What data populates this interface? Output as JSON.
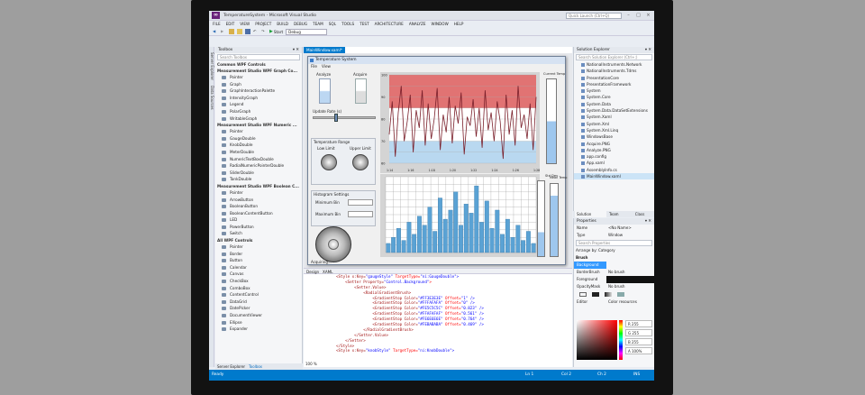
{
  "window": {
    "title": "TemperatureSystem - Microsoft Visual Studio",
    "quick_launch": "Quick Launch (Ctrl+Q)"
  },
  "menu": [
    "FILE",
    "EDIT",
    "VIEW",
    "PROJECT",
    "BUILD",
    "DEBUG",
    "TEAM",
    "SQL",
    "TOOLS",
    "TEST",
    "ARCHITECTURE",
    "ANALYZE",
    "WINDOW",
    "HELP"
  ],
  "toolbar": {
    "start_label": "Start",
    "config": "Debug"
  },
  "left_tabs": [
    "Server Explorer",
    "Data Sources"
  ],
  "toolbox": {
    "title": "Toolbox",
    "search": "Search Toolbox",
    "groups": [
      {
        "name": "Common WPF Controls",
        "items": []
      },
      {
        "name": "Measurement Studio WPF Graph Co...",
        "items": [
          "Pointer",
          "Graph",
          "GraphInteractionPalette",
          "IntensityGraph",
          "Legend",
          "PolarGraph",
          "WritableGraph"
        ]
      },
      {
        "name": "Measurement Studio WPF Numeric ...",
        "items": [
          "Pointer",
          "GaugeDouble",
          "KnobDouble",
          "MeterDouble",
          "NumericTextBoxDouble",
          "RadialNumericPointerDouble",
          "SliderDouble",
          "TankDouble"
        ]
      },
      {
        "name": "Measurement Studio WPF Boolean C...",
        "items": [
          "Pointer",
          "ArrowButton",
          "BooleanButton",
          "BooleanContentButton",
          "LED",
          "PowerButton",
          "Switch"
        ]
      },
      {
        "name": "All WPF Controls",
        "items": [
          "Pointer",
          "Border",
          "Button",
          "Calendar",
          "Canvas",
          "CheckBox",
          "ComboBox",
          "ContentControl",
          "DataGrid",
          "DatePicker",
          "DocumentViewer",
          "Ellipse",
          "Expander"
        ]
      }
    ],
    "bottom_tabs": [
      "Server Explorer",
      "Toolbox"
    ]
  },
  "editor": {
    "tab": "MainWindow.xaml*",
    "zoom": "100 %",
    "split_labels": [
      "Design",
      "XAML"
    ],
    "code": [
      [
        "<Style x:Key=",
        "\"gaugeStyle\"",
        " TargetType=",
        "\"ni:GaugeDouble\">"
      ],
      [
        "    <Setter Property=",
        "\"Control.Background\"",
        ">",
        ""
      ],
      [
        "        <Setter.Value>",
        "",
        "",
        ""
      ],
      [
        "            <RadialGradientBrush>",
        "",
        "",
        ""
      ],
      [
        "                <GradientStop Color=",
        "\"#FF3E3E3E\"",
        " Offset=",
        "\"1\" />"
      ],
      [
        "                <GradientStop Color=",
        "\"#FFFAFAFA\"",
        " Offset=",
        "\"0\" />"
      ],
      [
        "                <GradientStop Color=",
        "\"#FE5C5C5C\"",
        " Offset=",
        "\"0.823\" />"
      ],
      [
        "                <GradientStop Color=",
        "\"#FFAFAFAF\"",
        " Offset=",
        "\"0.561\" />"
      ],
      [
        "                <GradientStop Color=",
        "\"#FE6E6E6E\"",
        " Offset=",
        "\"0.764\" />"
      ],
      [
        "                <GradientStop Color=",
        "\"#FEBABABA\"",
        " Offset=",
        "\"0.469\" />"
      ],
      [
        "            </RadialGradientBrush>",
        "",
        "",
        ""
      ],
      [
        "        </Setter.Value>",
        "",
        "",
        ""
      ],
      [
        "    </Setter>",
        "",
        "",
        ""
      ],
      [
        "</Style>",
        "",
        "",
        ""
      ],
      [
        "<Style x:Key=",
        "\"knobStyle\"",
        " TargetType=",
        "\"ni:KnobDouble\">"
      ]
    ]
  },
  "app_window": {
    "title": "Temperature System",
    "menu": [
      "File",
      "View"
    ],
    "analyze_label": "Analyze",
    "acquire_label": "Acquire",
    "update_rate_label": "Update Rate (s)",
    "temp_range_label": "Temperature Range",
    "low_limit_label": "Low Limit",
    "upper_limit_label": "Upper Limit",
    "histogram_label": "Histogram Settings",
    "min_bin_label": "Minimum Bin",
    "max_bin_label": "Maximum Bin",
    "current_temp_label": "Current Temp",
    "std_dev_label": "Std Dev",
    "mean_temp_label": "Mean Temp",
    "status": "Acquiring..."
  },
  "solution": {
    "title": "Solution Explorer",
    "search": "Search Solution Explorer (Ctrl+;)",
    "items": [
      "NationalInstruments.Network",
      "NationalInstruments.Tdms",
      "PresentationCore",
      "PresentationFramework",
      "System",
      "System.Core",
      "System.Data",
      "System.Data.DataSetExtensions",
      "System.Xaml",
      "System.Xml",
      "System.Xml.Linq",
      "WindowsBase",
      "Acquire.PNG",
      "Analyze.PNG",
      "app.config",
      "App.xaml",
      "AssemblyInfo.cs",
      "MainWindow.xaml"
    ],
    "tabs": [
      "Solution Explorer",
      "Team Explorer",
      "Class View"
    ]
  },
  "properties": {
    "title": "Properties",
    "name_label": "Name",
    "name_value": "<No Name>",
    "type_label": "Type",
    "type_value": "Window",
    "search": "Search Properties",
    "arrange": "Arrange by: Category",
    "section": "Brush",
    "rows": [
      {
        "k": "Background",
        "v": ""
      },
      {
        "k": "BorderBrush",
        "v": "No brush"
      },
      {
        "k": "Foreground",
        "v": ""
      },
      {
        "k": "OpacityMask",
        "v": "No brush"
      }
    ],
    "editor_label": "Editor",
    "color_resources": "Color resources",
    "rgb": [
      "R 255",
      "G 255",
      "B 255",
      "A 100%"
    ]
  },
  "statusbar": {
    "left": "Ready",
    "ln": "Ln 1",
    "col": "Col 2",
    "ch": "Ch 2",
    "mode": "INS"
  },
  "chart_data": [
    {
      "type": "line",
      "title": "",
      "series": [
        {
          "name": "",
          "values": [
            73,
            88,
            63,
            83,
            95,
            70,
            79,
            91,
            65,
            84,
            76,
            93,
            68,
            87,
            71,
            80,
            94,
            66,
            82,
            74,
            90,
            69,
            86,
            78,
            92,
            64,
            81,
            77,
            89,
            72,
            85,
            67,
            93,
            75,
            83,
            70,
            88,
            79,
            62,
            91,
            73,
            84,
            68,
            95,
            76,
            82,
            71,
            87,
            66,
            90
          ]
        }
      ],
      "ylim": [
        60,
        100
      ],
      "x_ticks": [
        "1:14",
        "1:16",
        "1:18",
        "1:20",
        "1:22",
        "1:24",
        "1:26",
        "1:28"
      ]
    },
    {
      "type": "bar",
      "title": "",
      "values": [
        3,
        5,
        8,
        4,
        10,
        6,
        12,
        9,
        15,
        7,
        18,
        11,
        14,
        20,
        9,
        16,
        13,
        22,
        10,
        17,
        8,
        14,
        6,
        11,
        5,
        9,
        4,
        7,
        3
      ],
      "ylim": [
        0,
        25
      ]
    }
  ]
}
